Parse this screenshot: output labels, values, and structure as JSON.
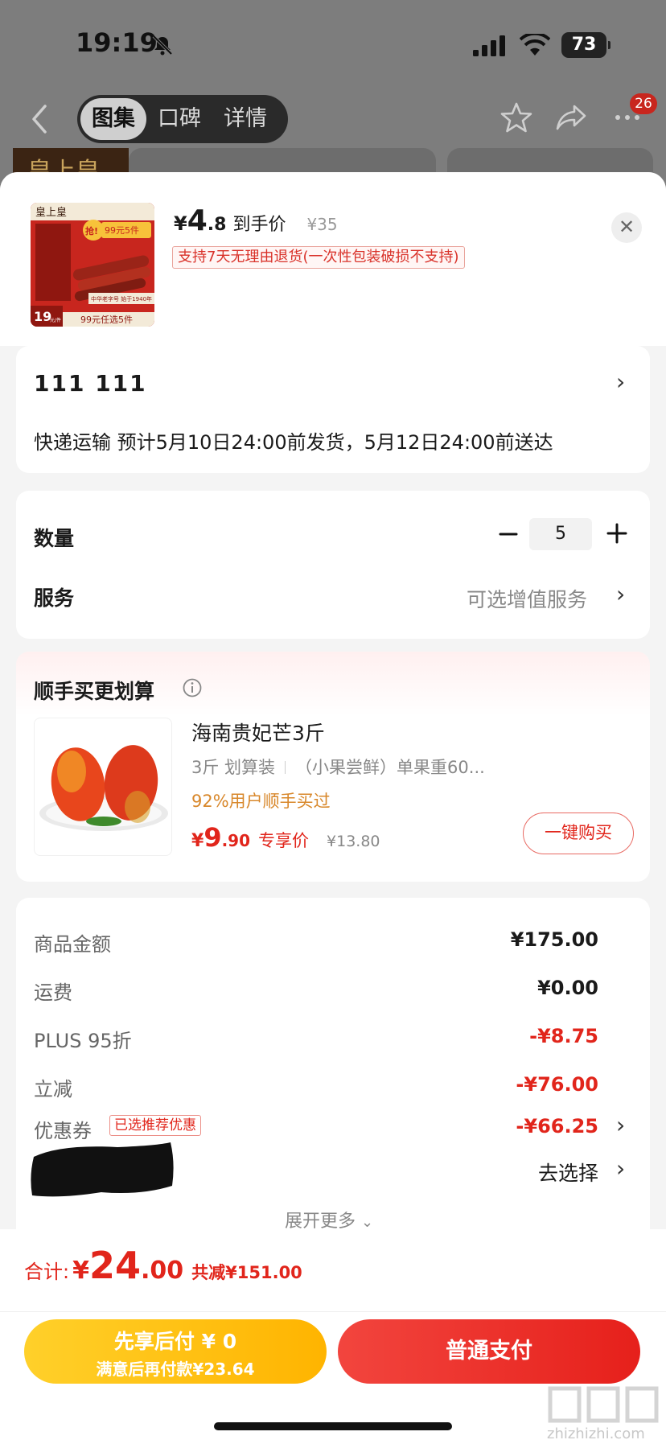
{
  "status_bar": {
    "time": "19:19",
    "battery": "73"
  },
  "nav": {
    "tabs": [
      {
        "label": "图集",
        "active": true
      },
      {
        "label": "口碑"
      },
      {
        "label": "详情"
      }
    ],
    "message_badge": "26",
    "background_logo": "皇上皇"
  },
  "product": {
    "price_yen": "¥",
    "price_int": "4",
    "price_dec": ".8",
    "price_label": "到手价",
    "original_price": "¥35",
    "return_policy": "支持7天无理由退货(一次性包装破损不支持)",
    "thumb": {
      "brand": "皇上皇",
      "promo_grab": "抢!",
      "promo_deal": "99元5件",
      "corner_price": "19",
      "corner_unit": "元/件",
      "bottom_banner": "99元任选5件",
      "small_caption": "中华老字号 始于1940年"
    }
  },
  "address": {
    "name": "111  111",
    "delivery": "快递运输 预计5月10日24:00前发货，5月12日24:00前送达"
  },
  "options": {
    "quantity_label": "数量",
    "quantity_value": "5",
    "service_label": "服务",
    "service_value": "可选增值服务"
  },
  "bundle": {
    "title": "顺手买更划算",
    "item_title": "海南贵妃芒3斤",
    "spec_1": "3斤 划算装",
    "spec_2": "（小果尝鲜）单果重60...",
    "social_proof": "92%用户顺手买过",
    "price_yen": "¥",
    "price_int": "9",
    "price_dec": ".90",
    "price_label": "专享价",
    "original_price": "¥13.80",
    "buy_button": "一键购买"
  },
  "summary": {
    "goods_amount_label": "商品金额",
    "goods_amount": "¥175.00",
    "shipping_label": "运费",
    "shipping": "¥0.00",
    "plus_label": "PLUS 95折",
    "plus_discount": "-¥8.75",
    "instant_label": "立减",
    "instant_discount": "-¥76.00",
    "coupon_label": "优惠券",
    "coupon_tag": "已选推荐优惠",
    "coupon_discount": "-¥66.25",
    "choose_label": "去选择",
    "expand_more": "展开更多"
  },
  "footer": {
    "total_label": "合计:",
    "total_yen": "¥",
    "total_int": "24",
    "total_dec": ".00",
    "total_saved": "共减¥151.00",
    "pay_later_line1": "先享后付 ¥ 0",
    "pay_later_line2": "满意后再付款¥23.64",
    "normal_pay": "普通支付",
    "watermark": "zhizhizhi.com"
  },
  "colors": {
    "accent_red": "#e1251b",
    "pay_later_yellow": "#ffc21a",
    "social_orange": "#d8872a",
    "overlay_gray": "#7d7d7d"
  },
  "icons": [
    "bell-slash-icon",
    "signal-icon",
    "wifi-icon",
    "battery-icon",
    "back-chevron-icon",
    "star-icon",
    "share-icon",
    "more-icon",
    "close-icon",
    "chevron-right-icon",
    "minus-icon",
    "plus-icon",
    "info-circle-icon",
    "chevron-down-icon"
  ]
}
